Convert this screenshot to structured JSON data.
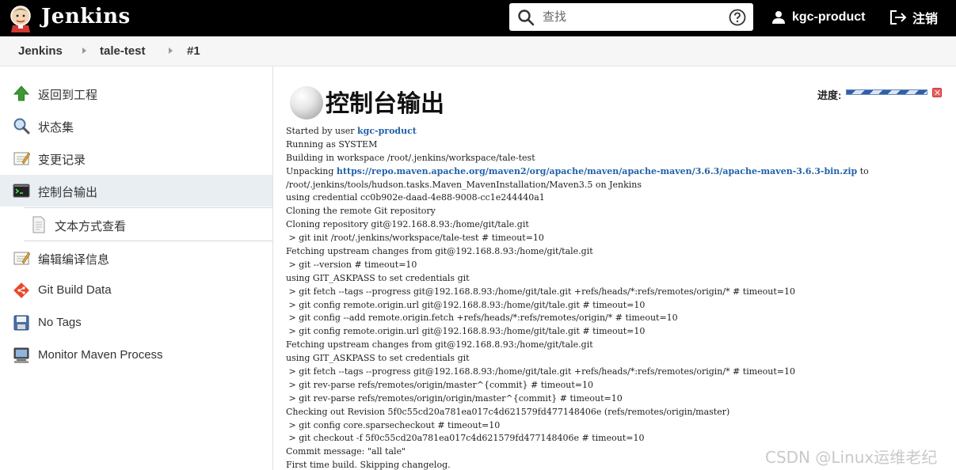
{
  "header": {
    "brand": "Jenkins",
    "search_placeholder": "查找",
    "user": "kgc-product",
    "logout": "注销"
  },
  "breadcrumb": [
    "Jenkins",
    "tale-test",
    "#1"
  ],
  "sidebar": {
    "items": [
      {
        "label": "返回到工程",
        "icon": "up-arrow-icon"
      },
      {
        "label": "状态集",
        "icon": "search-icon"
      },
      {
        "label": "变更记录",
        "icon": "notepad-icon"
      },
      {
        "label": "控制台输出",
        "icon": "terminal-icon",
        "active": true
      },
      {
        "label": "文本方式查看",
        "icon": "document-icon",
        "sub": true
      },
      {
        "label": "编辑编译信息",
        "icon": "notepad-icon"
      },
      {
        "label": "Git Build Data",
        "icon": "git-icon"
      },
      {
        "label": "No Tags",
        "icon": "save-icon"
      },
      {
        "label": "Monitor Maven Process",
        "icon": "computer-icon"
      }
    ]
  },
  "main": {
    "title": "控制台输出",
    "progress_label": "进度:",
    "console": [
      {
        "pre": "Started by user ",
        "link": "kgc-product",
        "post": ""
      },
      {
        "pre": "Running as SYSTEM"
      },
      {
        "pre": "Building in workspace /root/.jenkins/workspace/tale-test"
      },
      {
        "pre": "Unpacking ",
        "link": "https://repo.maven.apache.org/maven2/org/apache/maven/apache-maven/3.6.3/apache-maven-3.6.3-bin.zip",
        "post": " to"
      },
      {
        "pre": "/root/.jenkins/tools/hudson.tasks.Maven_MavenInstallation/Maven3.5 on Jenkins"
      },
      {
        "pre": "using credential cc0b902e-daad-4e88-9008-cc1e244440a1"
      },
      {
        "pre": "Cloning the remote Git repository"
      },
      {
        "pre": "Cloning repository git@192.168.8.93:/home/git/tale.git"
      },
      {
        "pre": " > git init /root/.jenkins/workspace/tale-test # timeout=10"
      },
      {
        "pre": "Fetching upstream changes from git@192.168.8.93:/home/git/tale.git"
      },
      {
        "pre": " > git --version # timeout=10"
      },
      {
        "pre": "using GIT_ASKPASS to set credentials git"
      },
      {
        "pre": " > git fetch --tags --progress git@192.168.8.93:/home/git/tale.git +refs/heads/*:refs/remotes/origin/* # timeout=10"
      },
      {
        "pre": " > git config remote.origin.url git@192.168.8.93:/home/git/tale.git # timeout=10"
      },
      {
        "pre": " > git config --add remote.origin.fetch +refs/heads/*:refs/remotes/origin/* # timeout=10"
      },
      {
        "pre": " > git config remote.origin.url git@192.168.8.93:/home/git/tale.git # timeout=10"
      },
      {
        "pre": "Fetching upstream changes from git@192.168.8.93:/home/git/tale.git"
      },
      {
        "pre": "using GIT_ASKPASS to set credentials git"
      },
      {
        "pre": " > git fetch --tags --progress git@192.168.8.93:/home/git/tale.git +refs/heads/*:refs/remotes/origin/* # timeout=10"
      },
      {
        "pre": " > git rev-parse refs/remotes/origin/master^{commit} # timeout=10"
      },
      {
        "pre": " > git rev-parse refs/remotes/origin/origin/master^{commit} # timeout=10"
      },
      {
        "pre": "Checking out Revision 5f0c55cd20a781ea017c4d621579fd477148406e (refs/remotes/origin/master)"
      },
      {
        "pre": " > git config core.sparsecheckout # timeout=10"
      },
      {
        "pre": " > git checkout -f 5f0c55cd20a781ea017c4d621579fd477148406e # timeout=10"
      },
      {
        "pre": "Commit message: \"all tale\""
      },
      {
        "pre": "First time build. Skipping changelog."
      }
    ]
  },
  "watermark": "CSDN @Linux运维老纪"
}
